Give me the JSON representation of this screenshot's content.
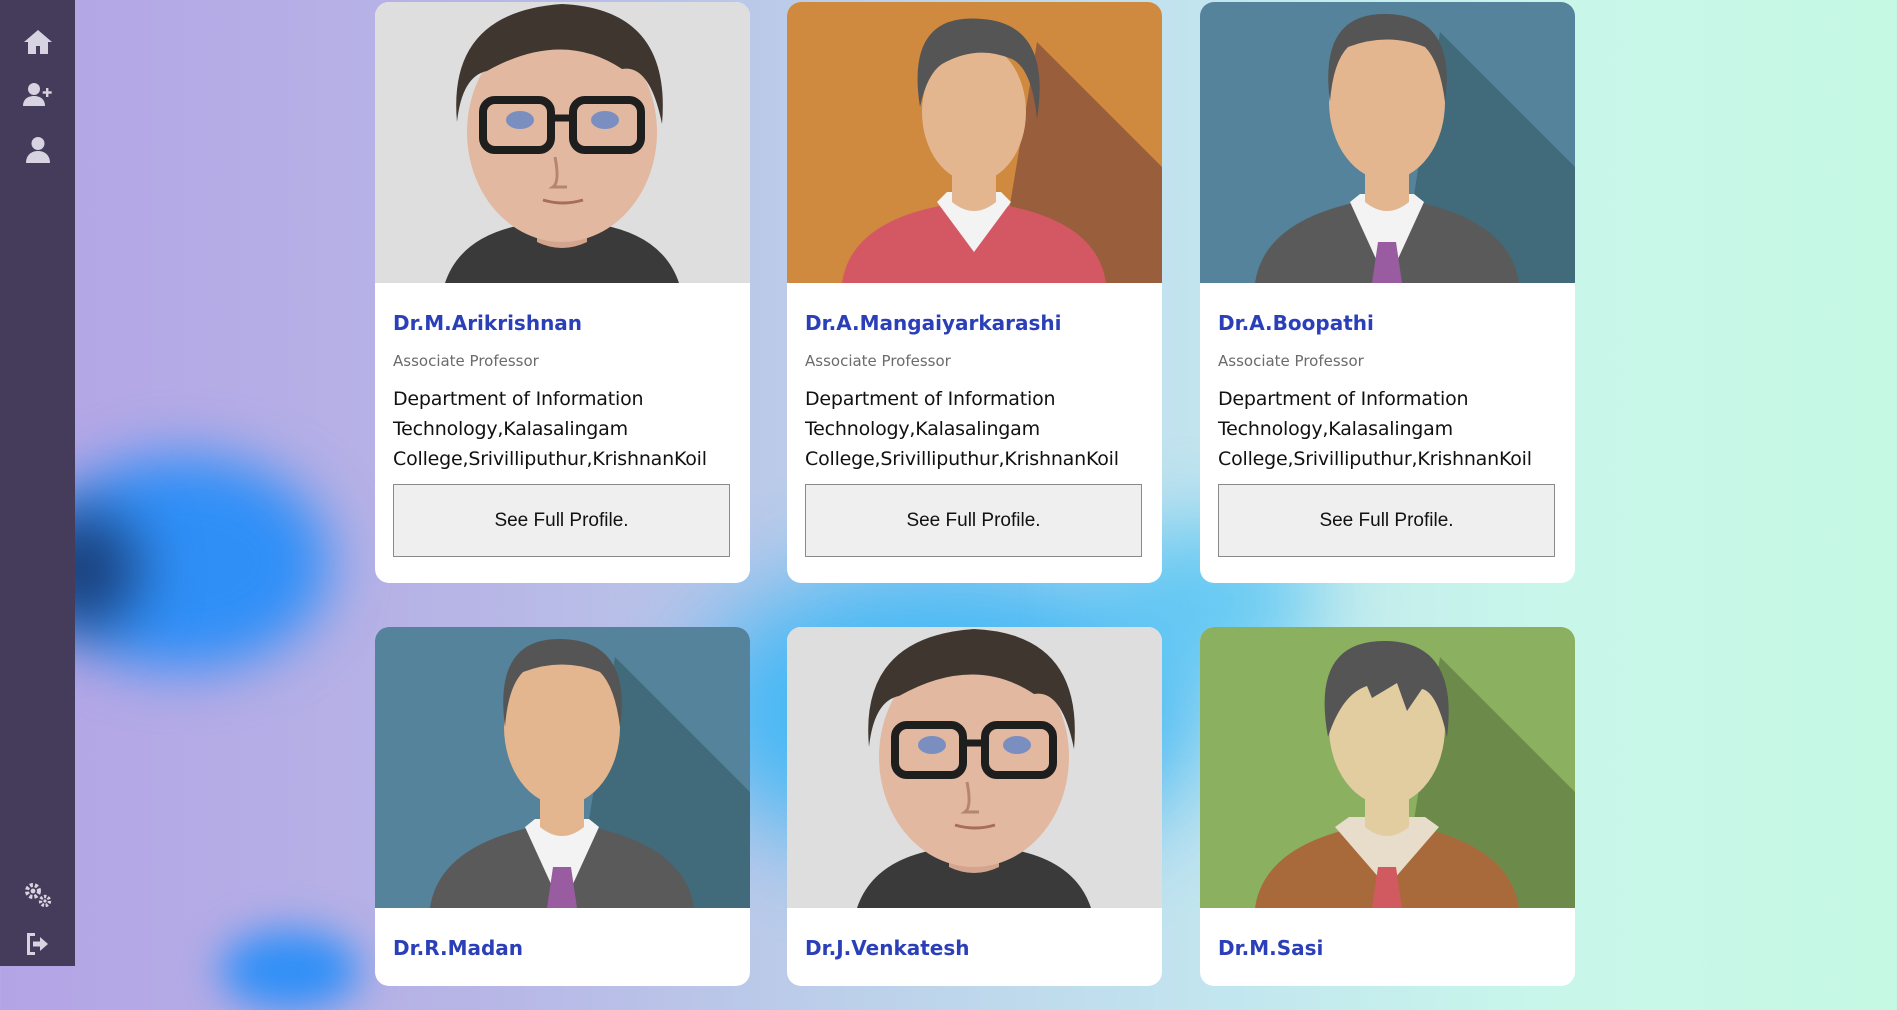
{
  "sidebar": {
    "items": [
      {
        "icon": "home-icon"
      },
      {
        "icon": "add-user-icon"
      },
      {
        "icon": "user-icon"
      },
      {
        "icon": "gears-icon"
      },
      {
        "icon": "logout-icon"
      }
    ]
  },
  "faculty": [
    {
      "name": "Dr.M.Arikrishnan",
      "role": "Associate Professor",
      "dept": "Department of Information Technology,Kalasalingam College,Srivilliputhur,KrishnanKoil",
      "button": "See Full Profile.",
      "avatar": "cartoon-glasses-avatar"
    },
    {
      "name": "Dr.A.Mangaiyarkarashi",
      "role": "Associate Professor",
      "dept": "Department of Information Technology,Kalasalingam College,Srivilliputhur,KrishnanKoil",
      "button": "See Full Profile.",
      "avatar": "female-avatar"
    },
    {
      "name": "Dr.A.Boopathi",
      "role": "Associate Professor",
      "dept": "Department of Information Technology,Kalasalingam College,Srivilliputhur,KrishnanKoil",
      "button": "See Full Profile.",
      "avatar": "male-tie-avatar"
    },
    {
      "name": "Dr.R.Madan",
      "avatar": "male-tie-avatar"
    },
    {
      "name": "Dr.J.Venkatesh",
      "avatar": "cartoon-glasses-avatar"
    },
    {
      "name": "Dr.M.Sasi",
      "avatar": "male-sweater-avatar"
    }
  ],
  "colors": {
    "name": "#2b40b8",
    "sidebar": "#443c5a"
  }
}
